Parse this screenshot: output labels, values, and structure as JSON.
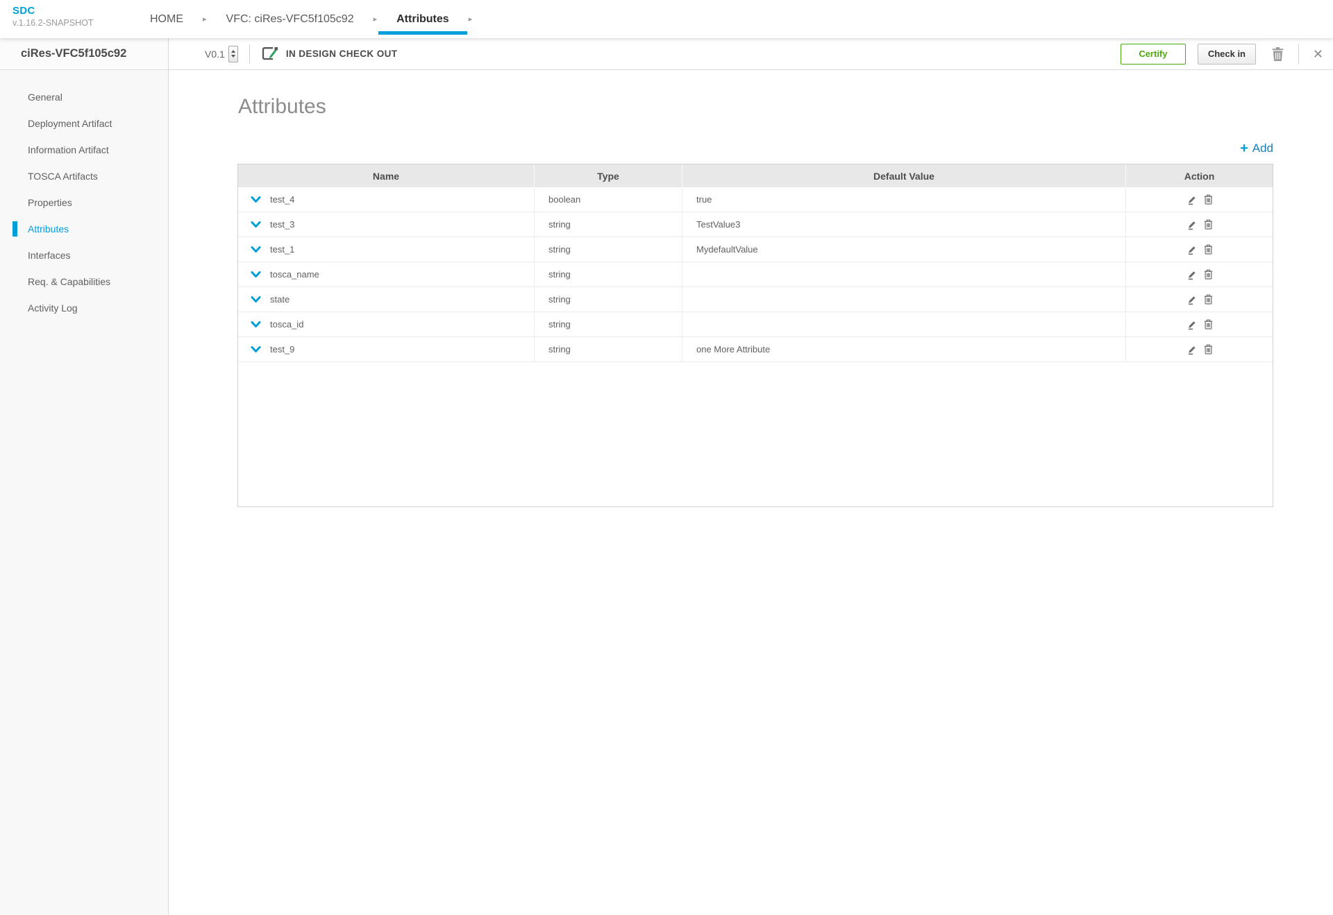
{
  "app": {
    "name": "SDC",
    "version": "v.1.16.2-SNAPSHOT"
  },
  "nav": {
    "tabs": [
      {
        "label": "HOME",
        "active": false
      },
      {
        "label": "VFC: ciRes-VFC5f105c92",
        "active": false
      },
      {
        "label": "Attributes",
        "active": true
      }
    ]
  },
  "entity": {
    "name": "ciRes-VFC5f105c92",
    "version": "V0.1",
    "status": "IN DESIGN CHECK OUT"
  },
  "toolbar": {
    "certify": "Certify",
    "checkin": "Check in"
  },
  "sidebar": {
    "items": [
      {
        "label": "General",
        "active": false
      },
      {
        "label": "Deployment Artifact",
        "active": false
      },
      {
        "label": "Information Artifact",
        "active": false
      },
      {
        "label": "TOSCA Artifacts",
        "active": false
      },
      {
        "label": "Properties",
        "active": false
      },
      {
        "label": "Attributes",
        "active": true
      },
      {
        "label": "Interfaces",
        "active": false
      },
      {
        "label": "Req. & Capabilities",
        "active": false
      },
      {
        "label": "Activity Log",
        "active": false
      }
    ]
  },
  "main": {
    "title": "Attributes",
    "add": {
      "plus": "+",
      "label": "Add"
    }
  },
  "table": {
    "columns": [
      "Name",
      "Type",
      "Default Value",
      "Action"
    ],
    "rows": [
      {
        "name": "test_4",
        "type": "boolean",
        "default": "true"
      },
      {
        "name": "test_3",
        "type": "string",
        "default": "TestValue3"
      },
      {
        "name": "test_1",
        "type": "string",
        "default": "MydefaultValue"
      },
      {
        "name": "tosca_name",
        "type": "string",
        "default": ""
      },
      {
        "name": "state",
        "type": "string",
        "default": ""
      },
      {
        "name": "tosca_id",
        "type": "string",
        "default": ""
      },
      {
        "name": "test_9",
        "type": "string",
        "default": "one More Attribute"
      }
    ]
  },
  "icons": {
    "breadcrumb_arrow": "▸",
    "close": "✕"
  },
  "colors": {
    "accent_blue": "#009fdb",
    "add_blue": "#1a7eb5",
    "certify_green": "#4ca90c",
    "pencil_green": "#2a9d5c"
  }
}
